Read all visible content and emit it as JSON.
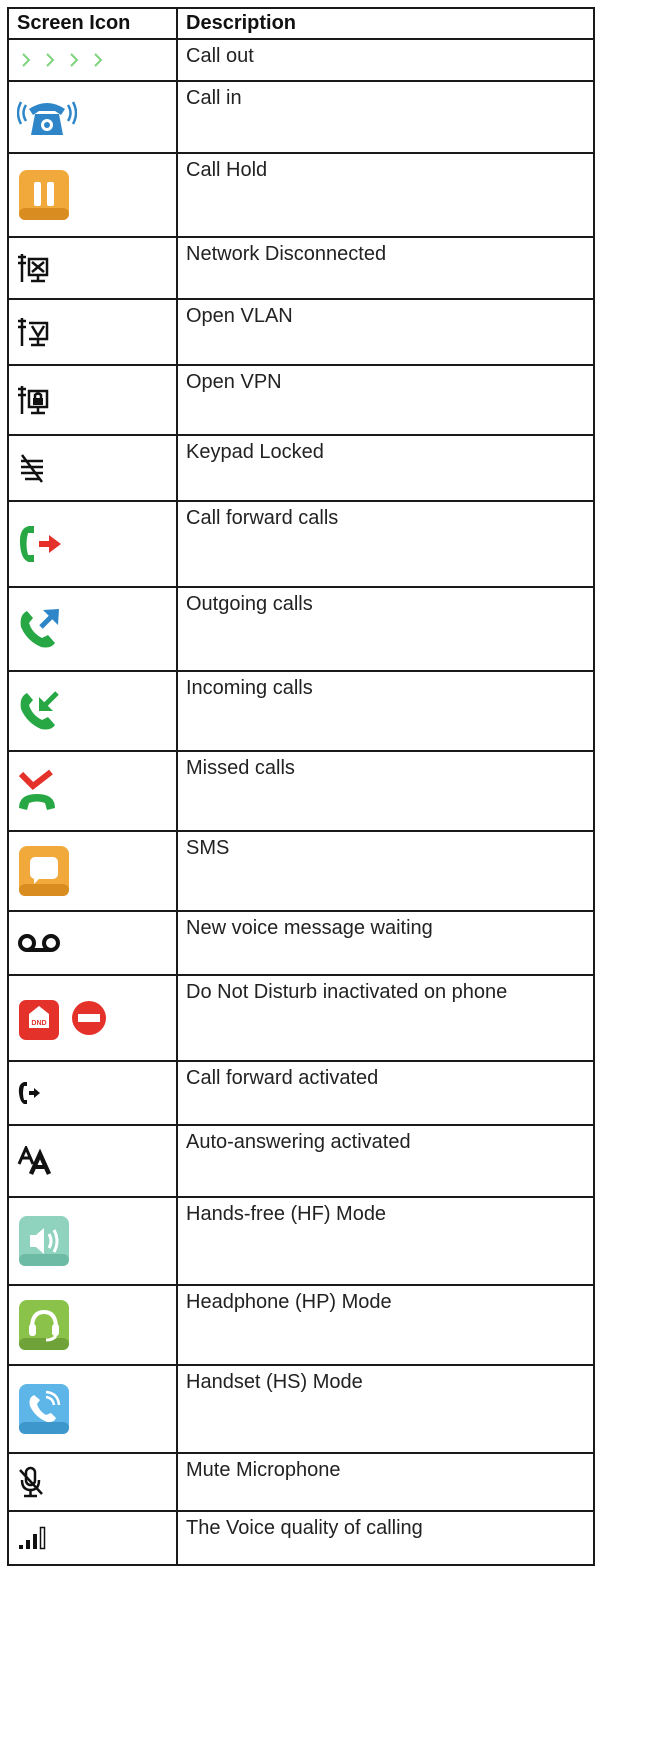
{
  "table": {
    "headers": {
      "icon": "Screen Icon",
      "description": "Description"
    },
    "rows": [
      {
        "icon": "call-out-arrows-icon",
        "description": "Call out"
      },
      {
        "icon": "call-in-phone-icon",
        "description": "Call in"
      },
      {
        "icon": "call-hold-pause-icon",
        "description": "Call Hold"
      },
      {
        "icon": "network-disconnected-icon",
        "description": "Network Disconnected"
      },
      {
        "icon": "vlan-icon",
        "description": "Open VLAN"
      },
      {
        "icon": "vpn-lock-icon",
        "description": "Open VPN"
      },
      {
        "icon": "keypad-locked-icon",
        "description": "Keypad Locked"
      },
      {
        "icon": "call-forward-calls-icon",
        "description": "Call forward calls"
      },
      {
        "icon": "outgoing-call-icon",
        "description": "Outgoing calls"
      },
      {
        "icon": "incoming-call-icon",
        "description": "Incoming calls"
      },
      {
        "icon": "missed-call-icon",
        "description": "Missed calls"
      },
      {
        "icon": "sms-icon",
        "description": "SMS"
      },
      {
        "icon": "voicemail-icon",
        "description": "New voice message waiting"
      },
      {
        "icon": "dnd-icon",
        "description": "Do Not Disturb inactivated on phone"
      },
      {
        "icon": "call-forward-activated-icon",
        "description": "Call forward activated"
      },
      {
        "icon": "auto-answer-icon",
        "description": "Auto-answering activated"
      },
      {
        "icon": "hands-free-speaker-icon",
        "description": "Hands-free (HF) Mode"
      },
      {
        "icon": "headphone-icon",
        "description": "Headphone (HP) Mode"
      },
      {
        "icon": "handset-icon",
        "description": "Handset (HS) Mode"
      },
      {
        "icon": "mute-microphone-icon",
        "description": "Mute Microphone"
      },
      {
        "icon": "signal-quality-icon",
        "description": "The Voice quality of calling"
      }
    ],
    "dnd_badge_text": "DND"
  },
  "colors": {
    "green": "#27a844",
    "blue": "#2e86c9",
    "red": "#e4322b",
    "orange": "#f2a93b",
    "light_green_arrow": "#7ed37e"
  }
}
